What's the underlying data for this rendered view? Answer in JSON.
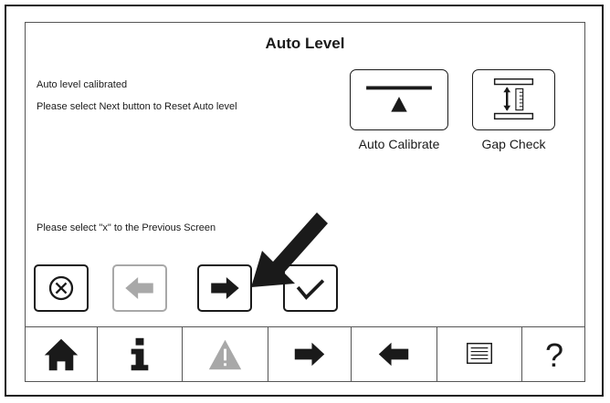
{
  "screen": {
    "title": "Auto Level",
    "messages": {
      "status": "Auto level calibrated",
      "instruction": "Please select Next button to Reset Auto level",
      "previous_hint": "Please select \"x\" to the Previous Screen"
    }
  },
  "tools": [
    {
      "label": "Auto Calibrate",
      "icon": "level-balance-icon"
    },
    {
      "label": "Gap Check",
      "icon": "gap-gauge-icon"
    }
  ],
  "actions": [
    {
      "name": "cancel",
      "icon": "circle-x-icon",
      "enabled": true
    },
    {
      "name": "back",
      "icon": "arrow-left-icon",
      "enabled": false
    },
    {
      "name": "next",
      "icon": "arrow-right-icon",
      "enabled": true
    },
    {
      "name": "confirm",
      "icon": "checkmark-icon",
      "enabled": true
    }
  ],
  "navbar": {
    "items": [
      {
        "name": "home",
        "icon": "home-icon",
        "enabled": true
      },
      {
        "name": "info",
        "icon": "info-icon",
        "glyph": "i",
        "enabled": true
      },
      {
        "name": "warning",
        "icon": "warning-icon",
        "enabled": false
      },
      {
        "name": "forward",
        "icon": "arrow-right-icon",
        "enabled": true
      },
      {
        "name": "back",
        "icon": "arrow-left-icon",
        "enabled": true
      },
      {
        "name": "list",
        "icon": "list-icon",
        "enabled": true
      },
      {
        "name": "help",
        "icon": "help-icon",
        "glyph": "?",
        "enabled": true
      }
    ]
  },
  "colors": {
    "ink": "#1a1a1a",
    "disabled": "#a8a8a8",
    "background": "#ffffff"
  }
}
